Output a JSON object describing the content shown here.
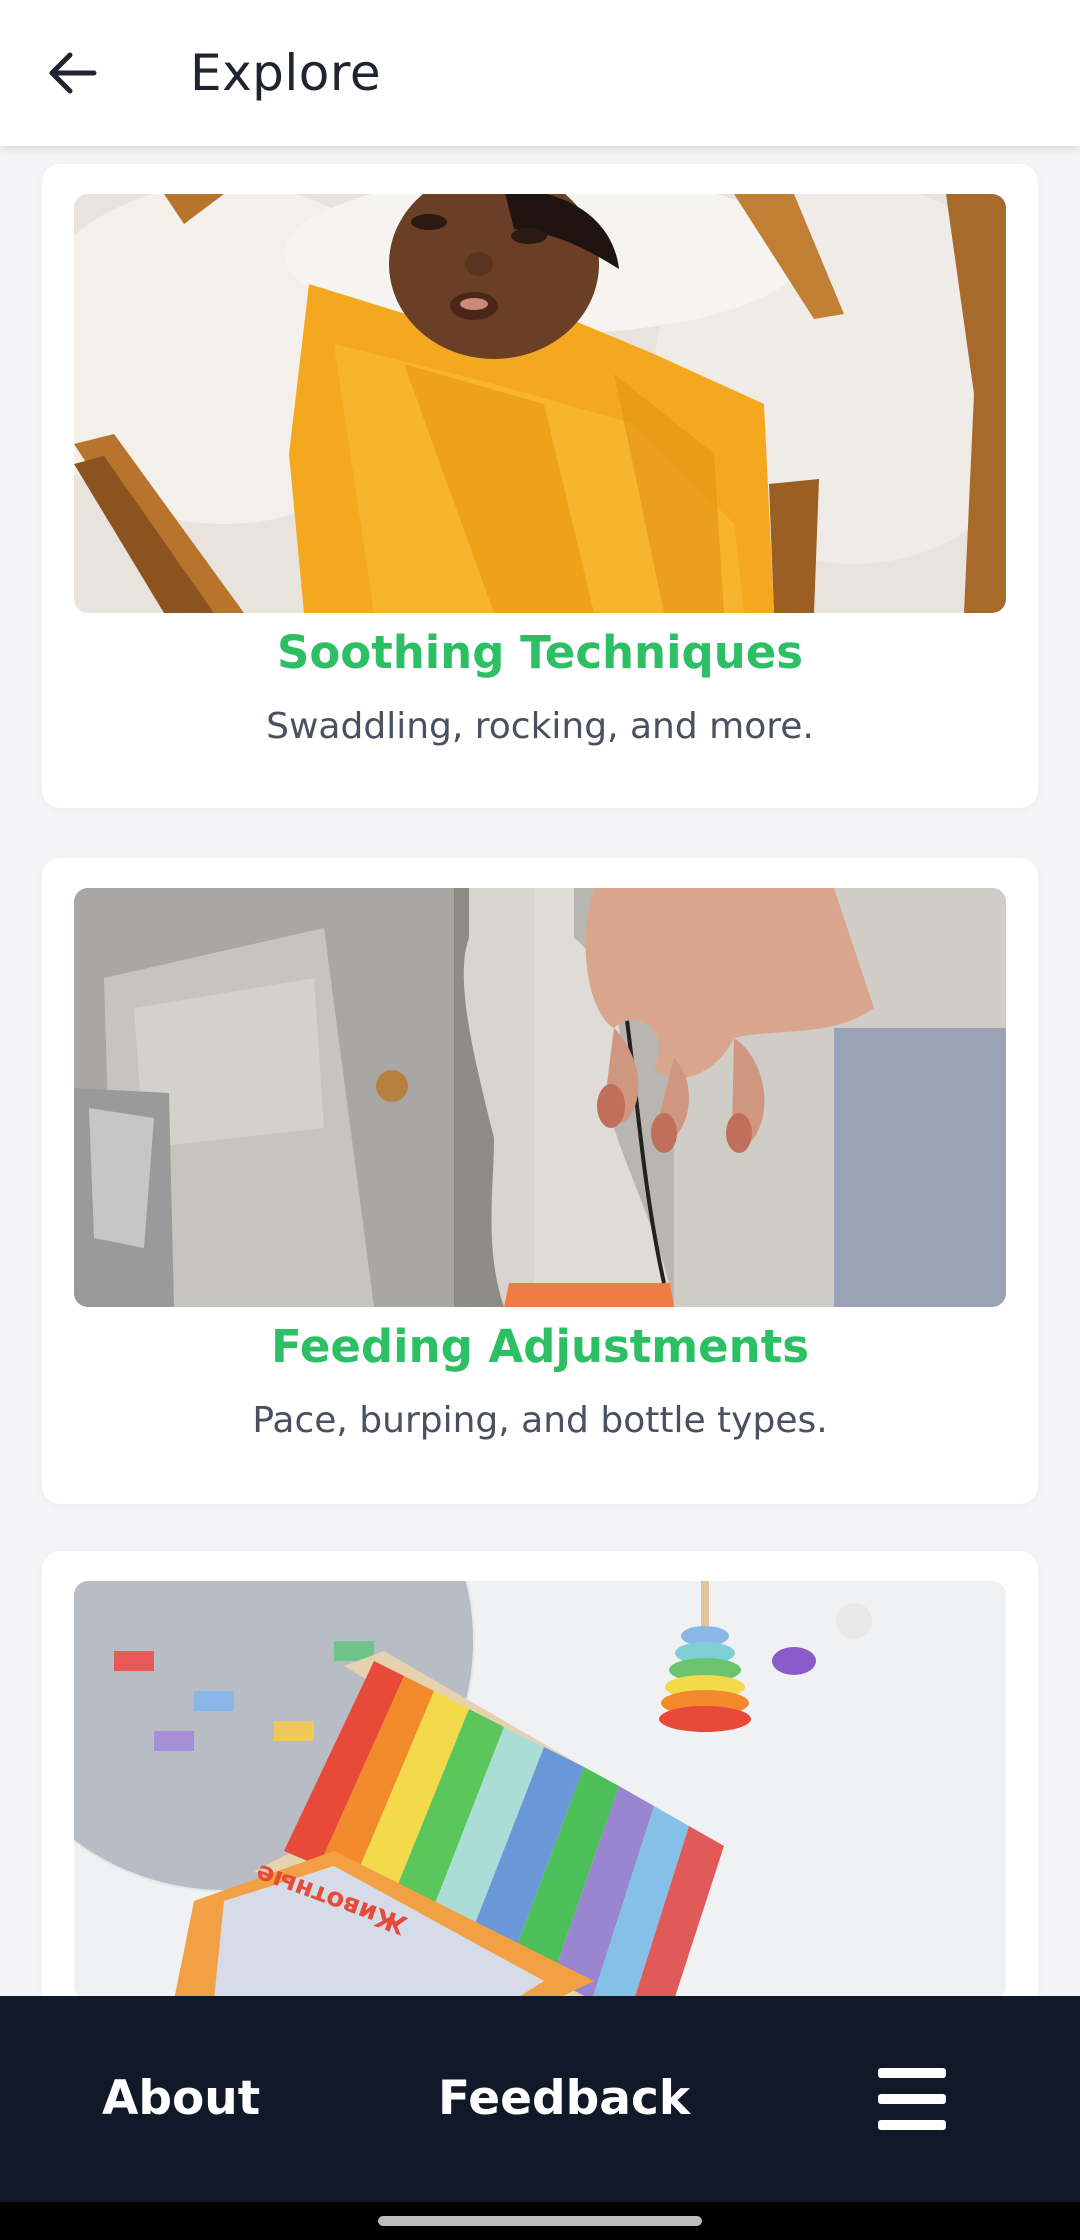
{
  "header": {
    "title": "Explore",
    "back_icon": "arrow-left-icon"
  },
  "cards": [
    {
      "title": "Soothing Techniques",
      "description": "Swaddling, rocking, and more.",
      "image_alt": "Newborn swaddled in a yellow blanket on a white fur rug"
    },
    {
      "title": "Feeding Adjustments",
      "description": "Pace, burping, and bottle types.",
      "image_alt": "Hand holding a baby bottle with measurement markings"
    },
    {
      "title": "",
      "description": "",
      "image_alt": "Colorful toy xylophone, stacking rings and a disco ball"
    }
  ],
  "bottom_nav": {
    "about_label": "About",
    "feedback_label": "Feedback",
    "menu_icon": "hamburger-menu-icon"
  },
  "colors": {
    "accent": "#2dbf63",
    "nav_background": "#111827",
    "swaddle_yellow": "#f5a623"
  }
}
